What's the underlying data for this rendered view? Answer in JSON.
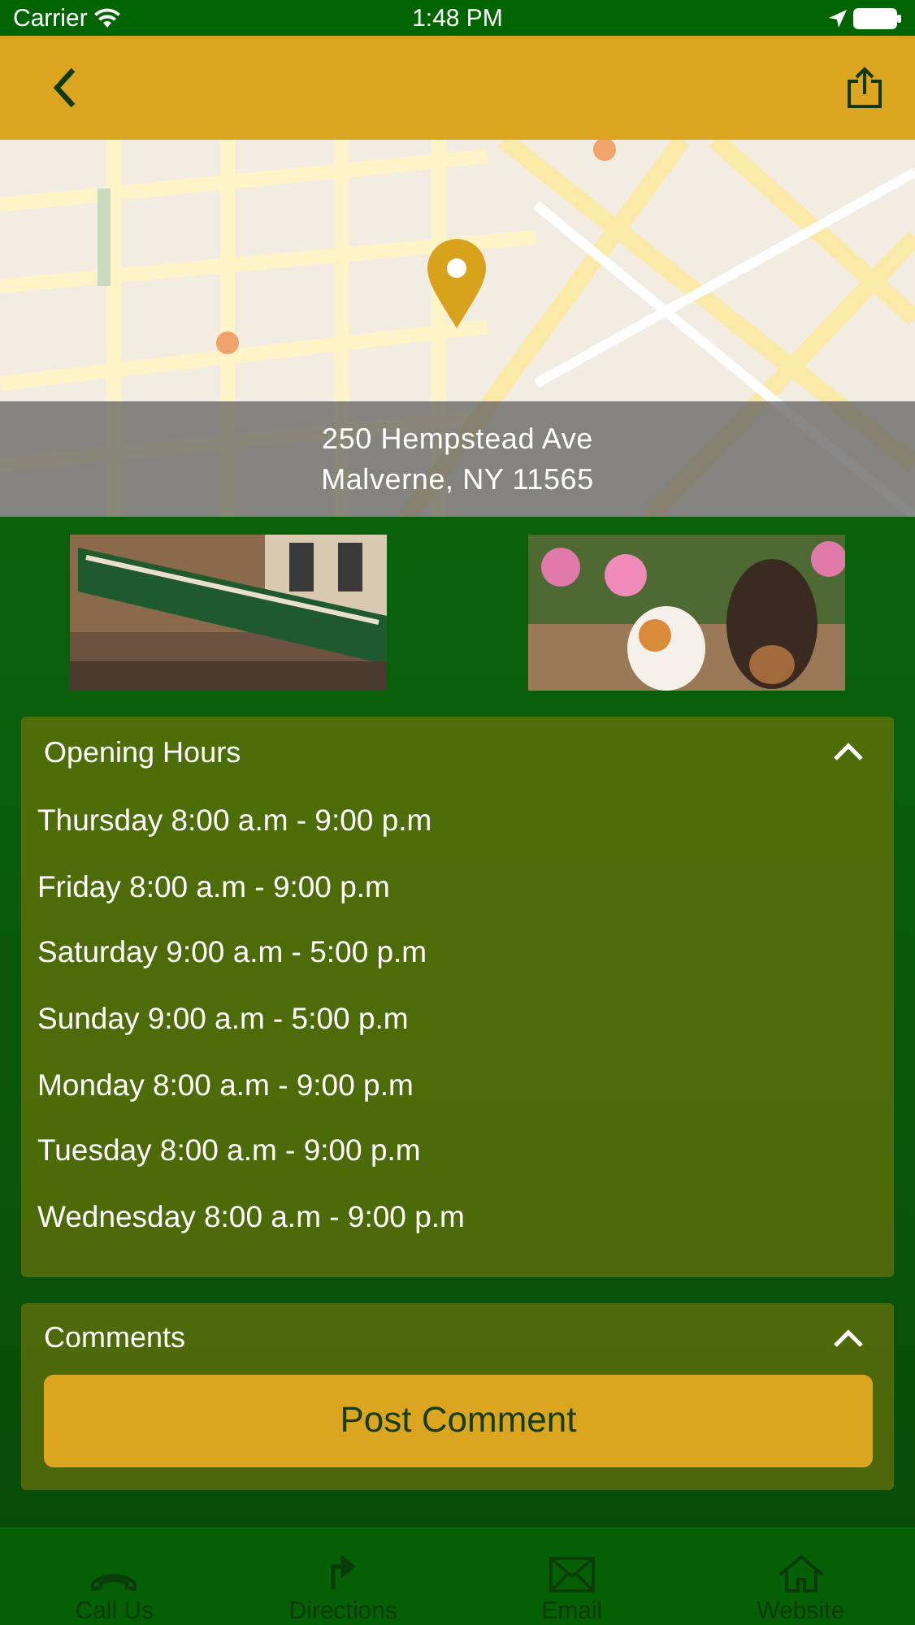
{
  "status_bar": {
    "carrier": "Carrier",
    "time": "1:48 PM"
  },
  "location": {
    "address_line_1": "250 Hempstead Ave",
    "address_line_2": "Malverne, NY 11565"
  },
  "opening_hours": {
    "title": "Opening Hours",
    "expanded": true,
    "rows": [
      {
        "text": "Thursday 8:00 a.m - 9:00 p.m"
      },
      {
        "text": "Friday 8:00 a.m - 9:00 p.m"
      },
      {
        "text": "Saturday 9:00 a.m - 5:00 p.m"
      },
      {
        "text": "Sunday 9:00 a.m - 5:00 p.m"
      },
      {
        "text": "Monday 8:00 a.m - 9:00 p.m"
      },
      {
        "text": "Tuesday 8:00 a.m - 9:00 p.m"
      },
      {
        "text": "Wednesday 8:00 a.m - 9:00 p.m"
      }
    ]
  },
  "comments": {
    "title": "Comments",
    "expanded": true,
    "button": "Post Comment"
  },
  "tab_bar": [
    {
      "label": "Call Us"
    },
    {
      "label": "Directions"
    },
    {
      "label": "Email"
    },
    {
      "label": "Website"
    }
  ]
}
